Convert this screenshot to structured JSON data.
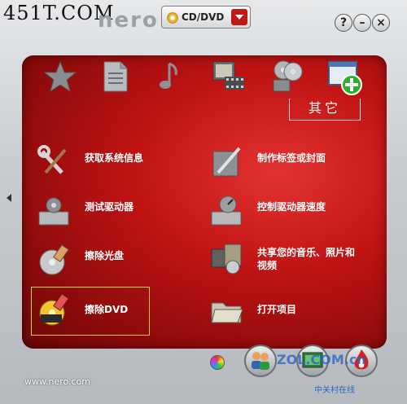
{
  "watermark": "451T.COM",
  "header": {
    "logo_text": "nero",
    "dropdown_value": "CD/DVD",
    "help_label": "?",
    "minimize_label": "–",
    "close_label": "×"
  },
  "category_tab": {
    "label": "其它"
  },
  "top_icons": [
    "favorites-star-icon",
    "data-document-icon",
    "music-note-icon",
    "photo-video-icon",
    "copy-backup-icon",
    "extras-add-icon"
  ],
  "tasks": [
    {
      "id": "system-info",
      "label": "获取系统信息",
      "icon": "wrench-screwdriver-icon"
    },
    {
      "id": "label-cover",
      "label": "制作标签或封面",
      "icon": "label-pen-icon"
    },
    {
      "id": "test-drive",
      "label": "测试驱动器",
      "icon": "drive-gear-icon"
    },
    {
      "id": "drive-speed",
      "label": "控制驱动器速度",
      "icon": "drive-speed-icon"
    },
    {
      "id": "erase-cd",
      "label": "擦除光盘",
      "icon": "disc-eraser-icon"
    },
    {
      "id": "share-media",
      "label": "共享您的音乐、照片和视频",
      "label_line1": "共享您的音乐、照片和",
      "label_line2": "视频",
      "icon": "share-media-icon"
    },
    {
      "id": "erase-dvd",
      "label": "擦除DVD",
      "icon": "dvd-eraser-icon"
    },
    {
      "id": "open-project",
      "label": "打开项目",
      "icon": "open-folder-icon"
    }
  ],
  "footer": {
    "url": "www.nero.com",
    "zol": "ZOL.COM.cn",
    "zol_sub": "中关村在线"
  },
  "colors": {
    "panel_red": "#c01313",
    "select_outline": "#f0d23c",
    "dropdown_button": "#c01818"
  }
}
